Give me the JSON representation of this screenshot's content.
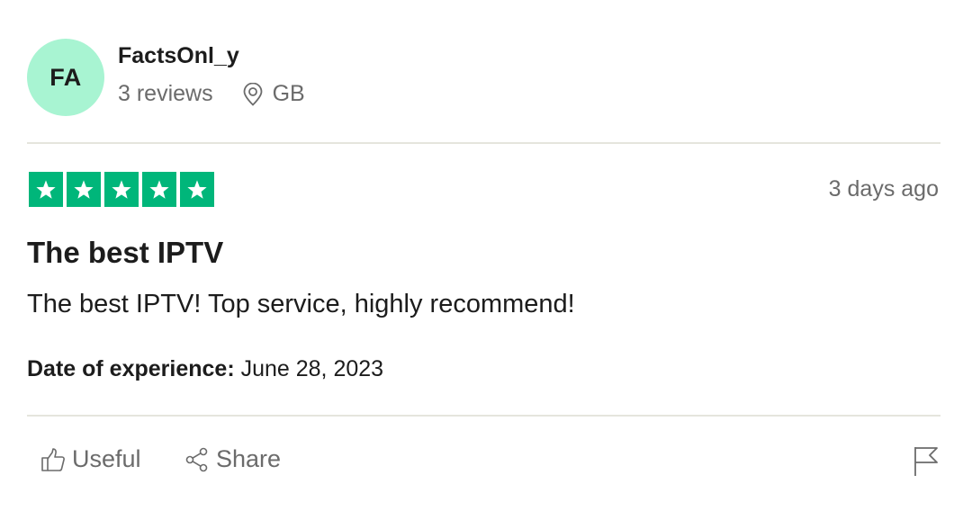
{
  "reviewer": {
    "initials": "FA",
    "name": "FactsOnl_y",
    "reviews_count": "3 reviews",
    "location": "GB",
    "avatar_color": "#a8f4d2"
  },
  "review": {
    "rating": 5,
    "rating_max": 5,
    "star_color": "#00b67a",
    "date": "3 days ago",
    "title": "The best IPTV",
    "body": "The best IPTV! Top service, highly recommend!",
    "experience_label": "Date of experience:",
    "experience_date": "June 28, 2023"
  },
  "actions": {
    "useful_label": "Useful",
    "useful_icon": "thumbs-up-icon",
    "share_label": "Share",
    "share_icon": "share-icon",
    "flag_icon": "flag-icon"
  }
}
